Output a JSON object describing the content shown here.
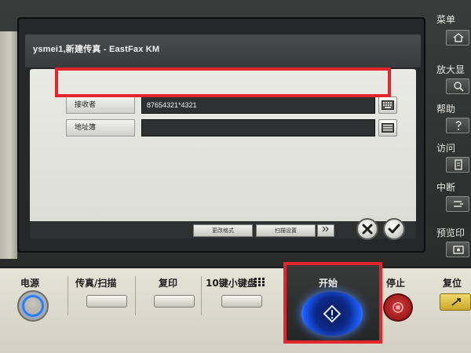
{
  "screen": {
    "title": "ysmei1,新建传真 - EastFax KM",
    "recipient_label": "接收者",
    "recipient_value": "87654321*4321",
    "addressbook_label": "地址簿",
    "bottom_tab_1": "更改格式",
    "bottom_tab_2": "扫描设置"
  },
  "side_menu": {
    "menu": "菜单",
    "zoom": "放大显",
    "help": "帮助",
    "access": "访问",
    "interrupt": "中断",
    "preview": "预览印"
  },
  "control_panel": {
    "power": "电源",
    "fax_scan": "传真/扫描",
    "copy": "复印",
    "keypad": "10键小键盘",
    "start": "开始",
    "stop": "停止",
    "reset": "复位"
  },
  "colors": {
    "highlight": "#e3262b",
    "start_glow": "#1c5dff"
  }
}
